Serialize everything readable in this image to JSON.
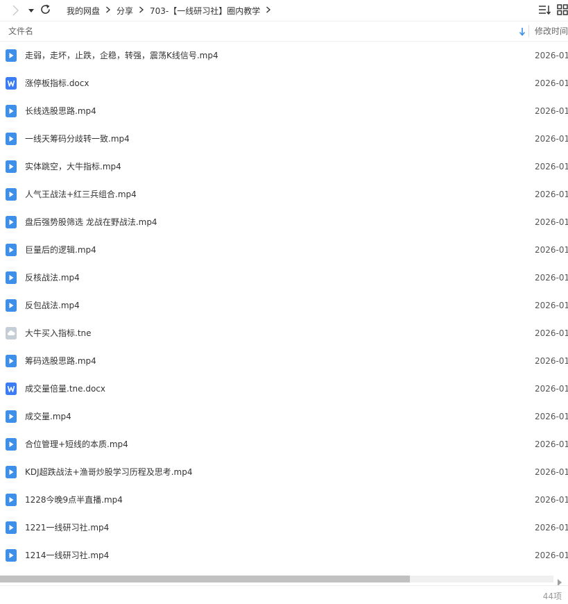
{
  "toolbar": {
    "forward_icon": "chevron-right-icon",
    "dropdown_icon": "caret-down-icon",
    "refresh_icon": "refresh-icon",
    "sort_icon": "sort-list-icon",
    "view_icon": "grid-view-icon"
  },
  "breadcrumb": [
    {
      "label": "我的网盘"
    },
    {
      "label": "分享"
    },
    {
      "label": "703-【一线研习社】圈内教学"
    }
  ],
  "header": {
    "name_label": "文件名",
    "modified_label": "修改时间",
    "sort_direction": "descending"
  },
  "colors": {
    "video": "#3d8fe8",
    "doc": "#3b7cf5",
    "cloud": "#c5cdd6",
    "accent": "#3a8ee6"
  },
  "files": [
    {
      "name": "走弱，走坏，止跌，企稳，转强，震荡K线信号.mp4",
      "date": "2026-01",
      "icon": "video"
    },
    {
      "name": "涨停板指标.docx",
      "date": "2026-01",
      "icon": "doc"
    },
    {
      "name": "长线选股思路.mp4",
      "date": "2026-01",
      "icon": "video"
    },
    {
      "name": "一线天筹码分歧转一致.mp4",
      "date": "2026-01",
      "icon": "video"
    },
    {
      "name": "实体跳空，大牛指标.mp4",
      "date": "2026-01",
      "icon": "video"
    },
    {
      "name": "人气王战法+红三兵组合.mp4",
      "date": "2026-01",
      "icon": "video"
    },
    {
      "name": "盘后强势股筛选  龙战在野战法.mp4",
      "date": "2026-01",
      "icon": "video"
    },
    {
      "name": "巨量后的逻辑.mp4",
      "date": "2026-01",
      "icon": "video"
    },
    {
      "name": "反核战法.mp4",
      "date": "2026-01",
      "icon": "video"
    },
    {
      "name": "反包战法.mp4",
      "date": "2026-01",
      "icon": "video"
    },
    {
      "name": "大牛买入指标.tne",
      "date": "2026-01",
      "icon": "cloud"
    },
    {
      "name": "筹码选股思路.mp4",
      "date": "2026-01",
      "icon": "video"
    },
    {
      "name": "成交量倍量.tne.docx",
      "date": "2026-01",
      "icon": "doc"
    },
    {
      "name": "成交量.mp4",
      "date": "2026-01",
      "icon": "video"
    },
    {
      "name": "合位管理+短线的本质.mp4",
      "date": "2026-01",
      "icon": "video"
    },
    {
      "name": "KDJ超跌战法+渔哥炒股学习历程及思考.mp4",
      "date": "2026-01",
      "icon": "video"
    },
    {
      "name": "1228今晚9点半直播.mp4",
      "date": "2026-01",
      "icon": "video"
    },
    {
      "name": "1221一线研习社.mp4",
      "date": "2026-01",
      "icon": "video"
    },
    {
      "name": "1214一线研习社.mp4",
      "date": "2026-01",
      "icon": "video"
    }
  ],
  "scrollbar": {
    "position_fraction": 0.74
  },
  "status": {
    "count": "44项"
  }
}
